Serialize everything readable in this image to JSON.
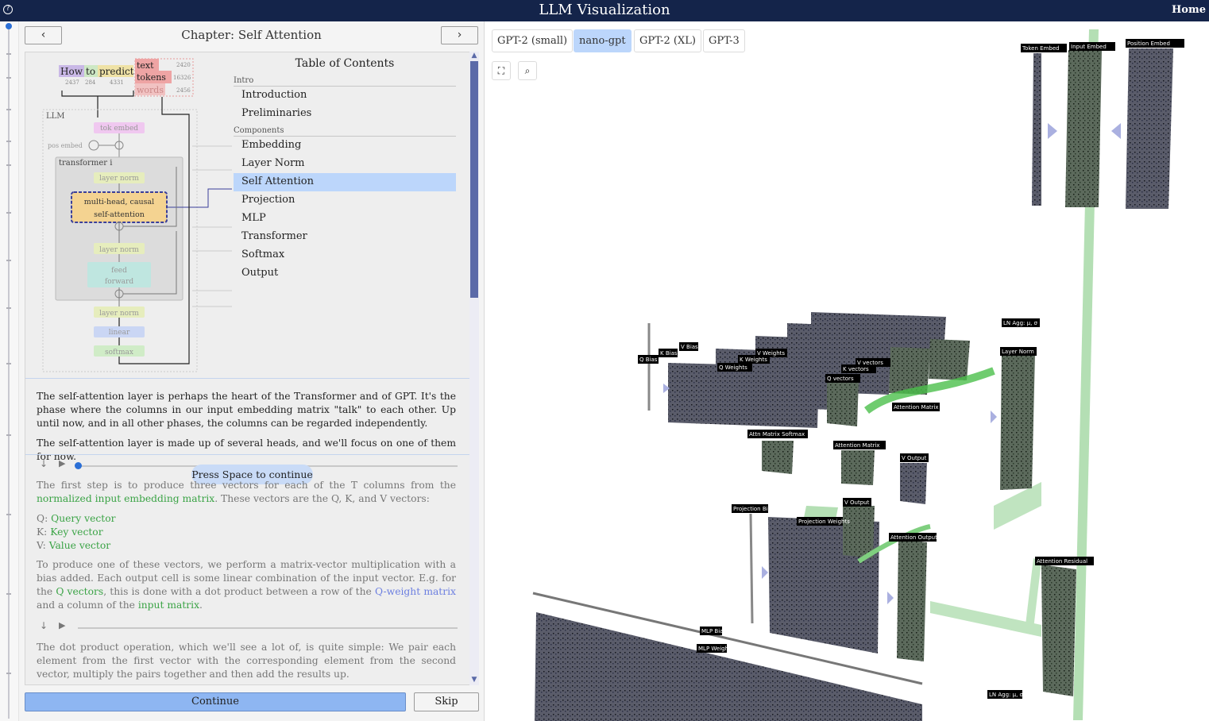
{
  "header": {
    "help_icon": "question-circle-icon",
    "title": "LLM Visualization",
    "home_label": "Home"
  },
  "nav": {
    "prev_icon": "chevron-left-icon",
    "next_icon": "chevron-right-icon",
    "chapter_title": "Chapter: Self Attention"
  },
  "diagram": {
    "tokens": [
      "How",
      "to",
      "predict"
    ],
    "token_ids": [
      "2437",
      "284",
      "4331"
    ],
    "output_words": [
      "text",
      "tokens",
      "words"
    ],
    "output_ids": [
      "2420",
      "16326",
      "2456"
    ],
    "llm_label": "LLM",
    "tok_embed": "tok embed",
    "pos_embed": "pos embed",
    "transformer_label": "transformer i",
    "layer_norm_1": "layer norm",
    "attention_line1": "multi-head, causal",
    "attention_line2": "self-attention",
    "layer_norm_2": "layer norm",
    "ff_line1": "feed",
    "ff_line2": "forward",
    "layer_norm_3": "layer norm",
    "linear": "linear",
    "softmax": "softmax"
  },
  "toc": {
    "title": "Table of Contents",
    "intro_header": "Intro",
    "intro_items": [
      "Introduction",
      "Preliminaries"
    ],
    "components_header": "Components",
    "component_items": [
      "Embedding",
      "Layer Norm",
      "Self Attention",
      "Projection",
      "MLP",
      "Transformer",
      "Softmax",
      "Output"
    ],
    "active": "Self Attention"
  },
  "content": {
    "para1": "The self-attention layer is perhaps the heart of the Transformer and of GPT. It's the phase where the columns in our input embedding matrix \"talk\" to each other. Up until now, and in all other phases, the columns can be regarded independently.",
    "para2": "The self-attention layer is made up of several heads, and we'll focus on one of them for now.",
    "press_space": "Press Space to continue",
    "step1_a": "The first step is to produce three vectors for each of the T columns from the ",
    "step1_link": "normalized input embedding matrix",
    "step1_b": ". These vectors are the Q, K, and V vectors:",
    "q_prefix": "Q: ",
    "q_label": "Query vector",
    "k_prefix": "K: ",
    "k_label": "Key vector",
    "v_prefix": "V: ",
    "v_label": "Value vector",
    "step2_a": "To produce one of these vectors, we perform a matrix-vector multiplication with a bias added. Each output cell is some linear combination of the input vector. E.g. for the ",
    "step2_link1": "Q vectors",
    "step2_b": ", this is done with a dot product between a row of the ",
    "step2_link2": "Q-weight matrix",
    "step2_c": " and a column of the ",
    "step2_link3": "input matrix",
    "step2_d": ".",
    "step3": "The dot product operation, which we'll see a lot of, is quite simple: We pair each element from the first vector with the corresponding element from the second vector, multiply the pairs together and then add the results up.",
    "progress": 0.0
  },
  "footer": {
    "continue_label": "Continue",
    "skip_label": "Skip"
  },
  "models": {
    "options": [
      "GPT-2 (small)",
      "nano-gpt",
      "GPT-2 (XL)",
      "GPT-3"
    ],
    "selected": "nano-gpt"
  },
  "tools": {
    "fullscreen_icon": "expand-icon",
    "search_icon": "magnify-icon"
  },
  "viz_labels": {
    "token_embed": "Token Embed",
    "input_embed": "Input Embed",
    "position_embed": "Position Embed",
    "ln_agg": "LN Agg: μ, σ",
    "layer_norm": "Layer Norm",
    "q_bias": "Q Bias",
    "k_bias": "K Bias",
    "v_bias": "V Bias",
    "q_weights": "Q Weights",
    "k_weights": "K Weights",
    "v_weights": "V Weights",
    "q_vectors": "Q vectors",
    "k_vectors": "K vectors",
    "v_vectors": "V vectors",
    "attention_matrix": "Attention Matrix",
    "attn_matrix_softmax": "Attn Matrix Softmax",
    "v_output": "V Output",
    "projection_bias": "Projection Bias",
    "projection_weights": "Projection Weights",
    "attention_output": "Attention Output",
    "attention_residual": "Attention Residual",
    "mlp_bias": "MLP Bias",
    "mlp_weights": "MLP Weights",
    "ln_agg_2": "LN Agg: μ, σ"
  }
}
